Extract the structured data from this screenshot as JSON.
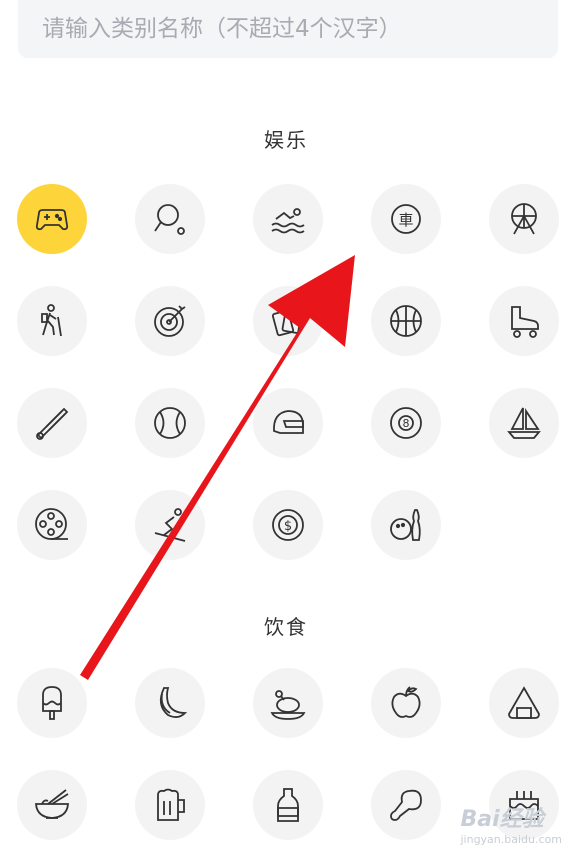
{
  "search": {
    "placeholder": "请输入类别名称（不超过4个汉字）"
  },
  "sections": [
    {
      "title": "娱乐",
      "icons": [
        "gamepad-icon",
        "ping-pong-icon",
        "swimming-icon",
        "car-badge-icon",
        "ferris-wheel-icon",
        "hiking-icon",
        "target-icon",
        "cards-icon",
        "basketball-icon",
        "roller-skate-icon",
        "badminton-icon",
        "baseball-icon",
        "helmet-icon",
        "billiard-ball-icon",
        "sailboat-icon",
        "film-reel-icon",
        "skiing-icon",
        "casino-chip-icon",
        "bowling-icon"
      ]
    },
    {
      "title": "饮食",
      "icons": [
        "popsicle-icon",
        "banana-icon",
        "roast-chicken-icon",
        "apple-icon",
        "rice-ball-icon",
        "noodle-bowl-icon",
        "beer-mug-icon",
        "bottle-icon",
        "drumstick-icon",
        "cake-icon"
      ]
    }
  ],
  "selected_icon": "gamepad-icon",
  "watermark": {
    "logo": "Bai经验",
    "url": "jingyan.baidu.com"
  },
  "colors": {
    "selected": "#fdd43a",
    "icon_bg": "#f3f3f4",
    "arrow": "#e8161b"
  }
}
